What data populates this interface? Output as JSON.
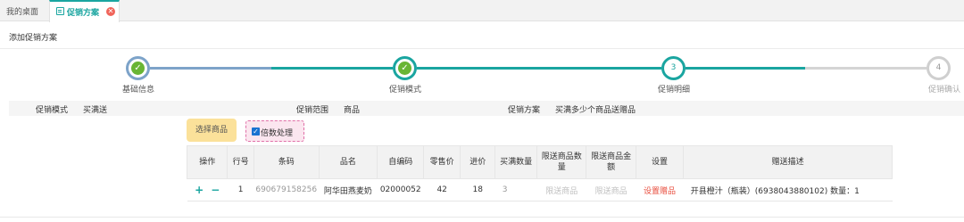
{
  "tabs": {
    "home_label": "我的桌面",
    "active_label": "促销方案",
    "close_icon": "close-icon"
  },
  "page": {
    "title": "添加促销方案"
  },
  "steps": [
    {
      "label": "基础信息",
      "status": "done"
    },
    {
      "label": "促销模式",
      "status": "done"
    },
    {
      "label": "促销明细",
      "status": "current",
      "number": "3"
    },
    {
      "label": "促销确认",
      "status": "pending",
      "number": "4"
    }
  ],
  "info": {
    "mode_key": "促销模式",
    "mode_val": "买满送",
    "scope_key": "促销范围",
    "scope_val": "商品",
    "plan_key": "促销方案",
    "plan_val": "买满多少个商品送赠品"
  },
  "controls": {
    "select_button": "选择商品",
    "multiple_label": "倍数处理",
    "multiple_checked": true
  },
  "table": {
    "headers": [
      "操作",
      "行号",
      "条码",
      "品名",
      "自编码",
      "零售价",
      "进价",
      "买满数量",
      "限送商品数量",
      "限送商品金额",
      "设置",
      "赠送描述"
    ],
    "rows": [
      {
        "line_no": "1",
        "barcode": "6906791582​56",
        "name": "阿华田燕麦奶",
        "code": "02000052",
        "retail": "42",
        "cost": "18",
        "qty": "3",
        "limit_qty": "限送商品",
        "limit_amt": "限送商品",
        "setting": "设置赠品",
        "desc": "开县橙汁（瓶装）(6938043880102) 数量：1"
      }
    ]
  },
  "colors": {
    "accent": "#1aa5a0",
    "done_check": "#69b534",
    "warning_link": "#e84d3d"
  }
}
